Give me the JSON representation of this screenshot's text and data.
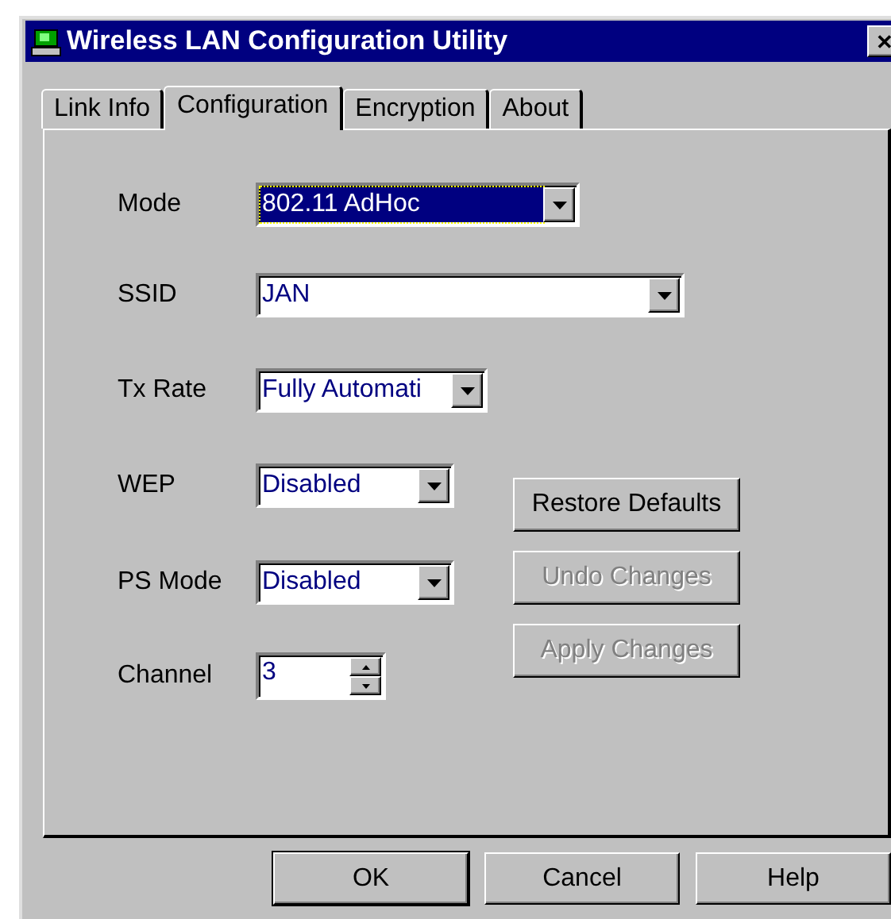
{
  "window": {
    "title": "Wireless LAN Configuration Utility",
    "close": "✕"
  },
  "tabs": [
    {
      "label": "Link Info",
      "selected": false
    },
    {
      "label": "Configuration",
      "selected": true
    },
    {
      "label": "Encryption",
      "selected": false
    },
    {
      "label": "About",
      "selected": false
    }
  ],
  "fields": [
    {
      "label": "Mode",
      "kind": "combo",
      "value": "802.11 AdHoc",
      "focused": true
    },
    {
      "label": "SSID",
      "kind": "combo",
      "value": "JAN",
      "focused": false
    },
    {
      "label": "Tx Rate",
      "kind": "combo",
      "value": "Fully Automati",
      "focused": false
    },
    {
      "label": "WEP",
      "kind": "combo",
      "value": "Disabled",
      "focused": false
    },
    {
      "label": "PS Mode",
      "kind": "combo",
      "value": "Disabled",
      "focused": false
    },
    {
      "label": "Channel",
      "kind": "spin",
      "value": "3",
      "focused": false
    }
  ],
  "side_buttons": [
    {
      "label": "Restore Defaults",
      "disabled": false
    },
    {
      "label": "Undo Changes",
      "disabled": true
    },
    {
      "label": "Apply Changes",
      "disabled": true
    }
  ],
  "dialog_buttons": [
    {
      "label": "OK",
      "default": true
    },
    {
      "label": "Cancel",
      "default": false
    },
    {
      "label": "Help",
      "default": false
    }
  ]
}
